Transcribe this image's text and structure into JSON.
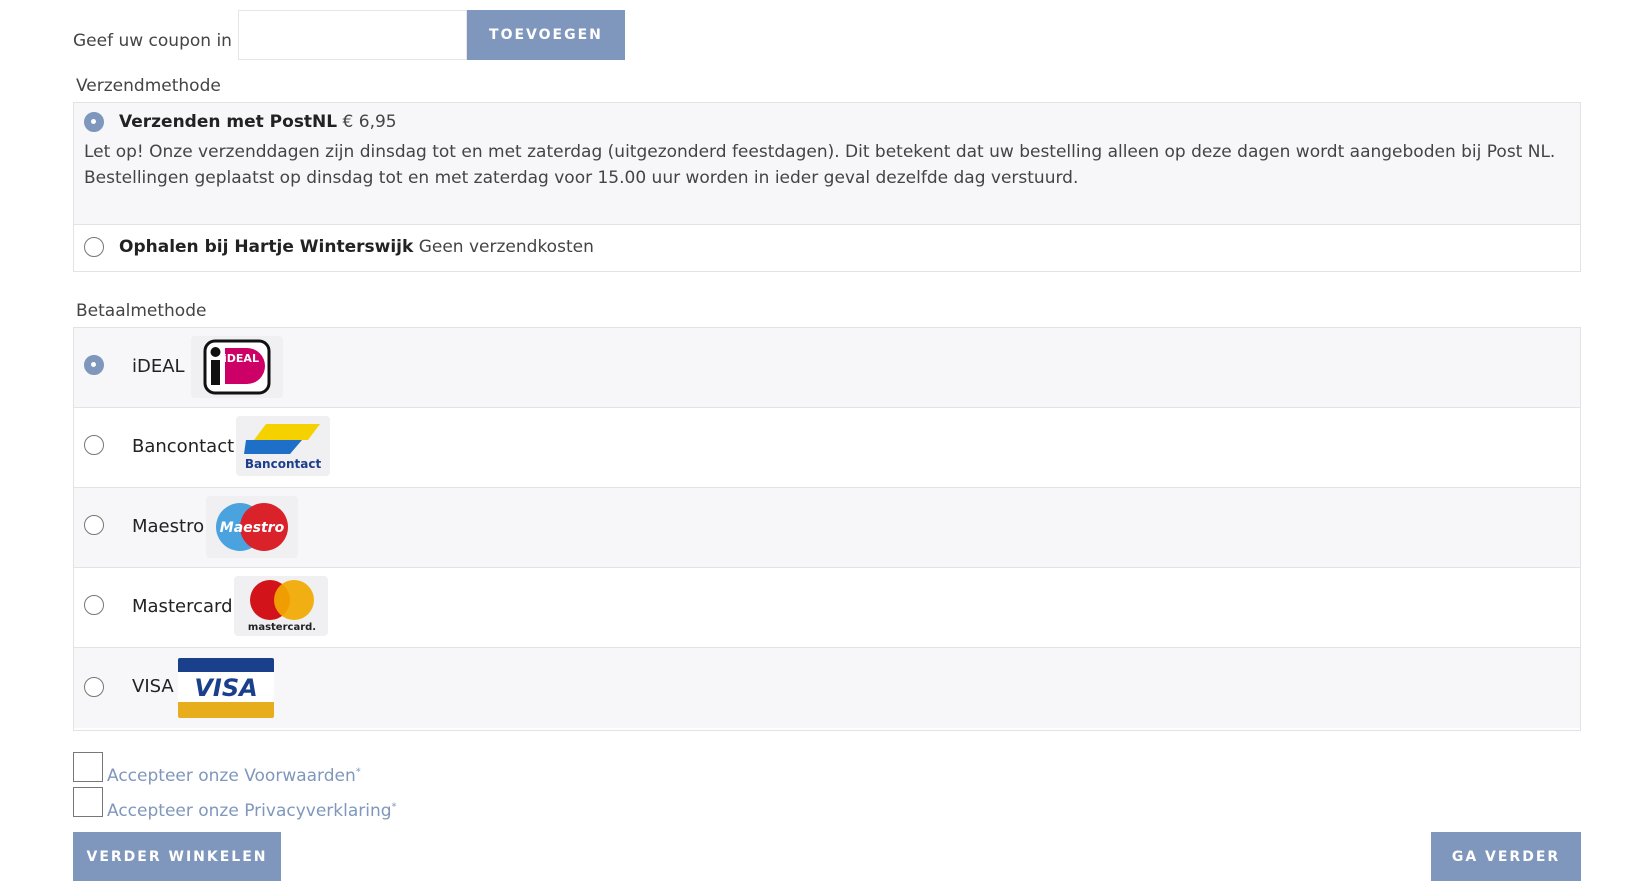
{
  "coupon": {
    "label": "Geef uw coupon in",
    "value": "",
    "placeholder": "",
    "button_label": "TOEVOEGEN"
  },
  "shipping": {
    "title": "Verzendmethode",
    "options": [
      {
        "name": "Verzenden met PostNL",
        "price": "€ 6,95",
        "note": "Let op! Onze verzenddagen zijn dinsdag tot en met zaterdag (uitgezonderd feestdagen). Dit betekent dat uw bestelling alleen op deze dagen wordt aangeboden bij Post NL. Bestellingen geplaatst op dinsdag tot en met zaterdag voor 15.00 uur worden in ieder geval dezelfde dag verstuurd.",
        "selected": true
      },
      {
        "name": "Ophalen bij Hartje Winterswijk",
        "price": "Geen verzendkosten",
        "selected": false
      }
    ]
  },
  "payment": {
    "title": "Betaalmethode",
    "options": [
      {
        "label": "iDEAL",
        "logo_text": "iDEAL",
        "icon": "ideal-logo-icon",
        "selected": true
      },
      {
        "label": "Bancontact",
        "logo_text": "Bancontact",
        "icon": "bancontact-logo-icon",
        "selected": false
      },
      {
        "label": "Maestro",
        "logo_text": "Maestro",
        "icon": "maestro-logo-icon",
        "selected": false
      },
      {
        "label": "Mastercard",
        "logo_text": "mastercard.",
        "icon": "mastercard-logo-icon",
        "selected": false
      },
      {
        "label": "VISA",
        "logo_text": "VISA",
        "icon": "visa-logo-icon",
        "selected": false
      }
    ]
  },
  "agreements": {
    "terms_label": "Accepteer onze Voorwaarden",
    "privacy_label": "Accepteer onze Privacyverklaring",
    "required_mark": "*"
  },
  "actions": {
    "continue_shopping": "VERDER WINKELEN",
    "proceed": "GA VERDER"
  },
  "colors": {
    "accent": "#7f97bc",
    "row_alt": "#f7f7f9",
    "border": "#e3e3e6"
  }
}
